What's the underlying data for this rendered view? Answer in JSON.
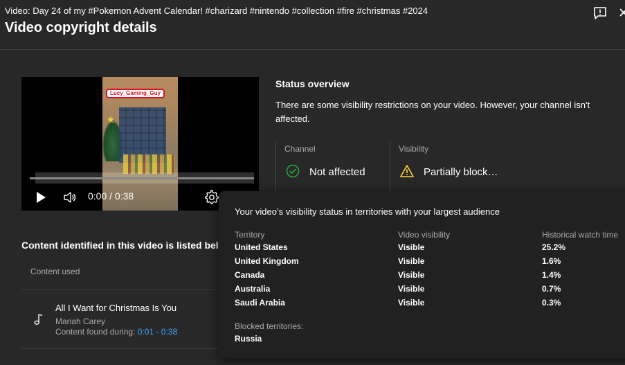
{
  "header": {
    "video_title_line": "Video: Day 24 of my #Pokemon Advent Calendar! #charizard #nintendo #collection #fire #christmas #2024",
    "dialog_title": "Video copyright details",
    "feedback_icon": "feedback-icon",
    "close_icon": "close-icon"
  },
  "player": {
    "channel_tag": "Lucy_Gaming_Guy",
    "time": "0:00 / 0:38",
    "progress": 0,
    "icons": [
      "play-icon",
      "volume-icon",
      "settings-gear-icon"
    ]
  },
  "status": {
    "title": "Status overview",
    "description": "There are some visibility restrictions on your video. However, your channel isn't affected.",
    "channel_label": "Channel",
    "channel_value": "Not affected",
    "visibility_label": "Visibility",
    "visibility_value": "Partially block…",
    "colors": {
      "ok": "#2ba640",
      "warn": "#ffd43b"
    }
  },
  "content": {
    "heading": "Content identified in this video is listed bel",
    "column_label": "Content used",
    "item": {
      "title": "All I Want for Christmas Is You",
      "artist": "Mariah Carey",
      "found_prefix": "Content found during: ",
      "found_range": "0:01 - 0:38"
    }
  },
  "tooltip": {
    "title": "Your video’s visibility status in territories with your largest audience",
    "columns": [
      "Territory",
      "Video visibility",
      "Historical watch time"
    ],
    "rows": [
      {
        "territory": "United States",
        "visibility": "Visible",
        "watch_time": "25.2%"
      },
      {
        "territory": "United Kingdom",
        "visibility": "Visible",
        "watch_time": "1.6%"
      },
      {
        "territory": "Canada",
        "visibility": "Visible",
        "watch_time": "1.4%"
      },
      {
        "territory": "Australia",
        "visibility": "Visible",
        "watch_time": "0.7%"
      },
      {
        "territory": "Saudi Arabia",
        "visibility": "Visible",
        "watch_time": "0.3%"
      }
    ],
    "blocked_label": "Blocked territories:",
    "blocked_value": "Russia"
  }
}
